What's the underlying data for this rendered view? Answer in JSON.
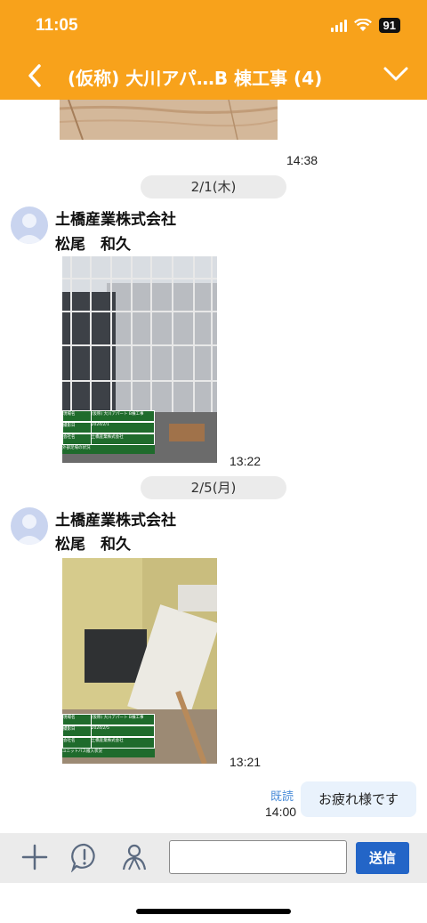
{
  "status_bar": {
    "time": "11:05",
    "battery": "91"
  },
  "header": {
    "title": "(仮称) 大川アパ…B 棟工事 (4)"
  },
  "messages": [
    {
      "time": "14:38"
    },
    {
      "date": "2/1(木)",
      "company": "土橋産業株式会社",
      "person": "松尾　和久",
      "board": {
        "rows": [
          [
            "現場名",
            "(仮称) 大川アパート B棟工事"
          ],
          [
            "撮影日",
            "2024/2/1"
          ],
          [
            "会社名",
            "土橋産業株式会社"
          ]
        ],
        "caption": "外部足場の状況"
      },
      "time": "13:22"
    },
    {
      "date": "2/5(月)",
      "company": "土橋産業株式会社",
      "person": "松尾　和久",
      "board": {
        "rows": [
          [
            "現場名",
            "(仮称) 大川アパート B棟工事"
          ],
          [
            "撮影日",
            "2024/2/5"
          ],
          [
            "会社名",
            "土橋産業株式会社"
          ]
        ],
        "caption": "ユニットバス搬入状況"
      },
      "time": "13:21"
    },
    {
      "read_label": "既読",
      "time": "14:00",
      "text": "お疲れ様です"
    }
  ],
  "composer": {
    "send_label": "送信",
    "placeholder": ""
  },
  "icons": [
    "back-chevron-icon",
    "chevron-down-icon",
    "plus-icon",
    "alert-bubble-icon",
    "person-icon"
  ]
}
